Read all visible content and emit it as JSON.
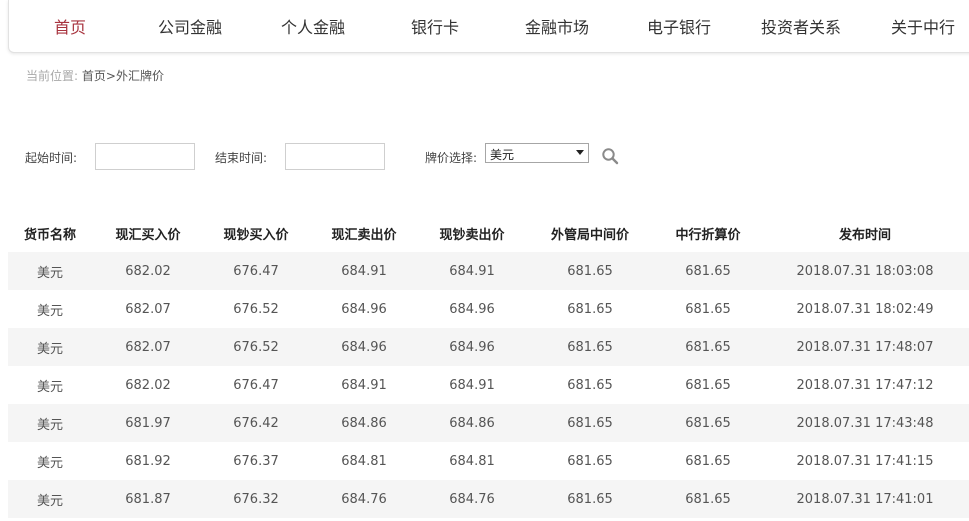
{
  "nav": {
    "items": [
      {
        "label": "首页",
        "active": true
      },
      {
        "label": "公司金融",
        "active": false
      },
      {
        "label": "个人金融",
        "active": false
      },
      {
        "label": "银行卡",
        "active": false
      },
      {
        "label": "金融市场",
        "active": false
      },
      {
        "label": "电子银行",
        "active": false
      },
      {
        "label": "投资者关系",
        "active": false
      },
      {
        "label": "关于中行",
        "active": false
      }
    ],
    "active_color": "#a8343f"
  },
  "breadcrumb": {
    "prefix": "当前位置:",
    "home": "首页",
    "separator": ">",
    "current": "外汇牌价"
  },
  "filters": {
    "start_label": "起始时间:",
    "start_value": "",
    "end_label": "结束时间:",
    "end_value": "",
    "currency_label": "牌价选择:",
    "currency_selected": "美元",
    "search_icon": "search-icon"
  },
  "table": {
    "headers": [
      "货币名称",
      "现汇买入价",
      "现钞买入价",
      "现汇卖出价",
      "现钞卖出价",
      "外管局中间价",
      "中行折算价",
      "发布时间"
    ],
    "rows": [
      [
        "美元",
        "682.02",
        "676.47",
        "684.91",
        "684.91",
        "681.65",
        "681.65",
        "2018.07.31 18:03:08"
      ],
      [
        "美元",
        "682.07",
        "676.52",
        "684.96",
        "684.96",
        "681.65",
        "681.65",
        "2018.07.31 18:02:49"
      ],
      [
        "美元",
        "682.07",
        "676.52",
        "684.96",
        "684.96",
        "681.65",
        "681.65",
        "2018.07.31 17:48:07"
      ],
      [
        "美元",
        "682.02",
        "676.47",
        "684.91",
        "684.91",
        "681.65",
        "681.65",
        "2018.07.31 17:47:12"
      ],
      [
        "美元",
        "681.97",
        "676.42",
        "684.86",
        "684.86",
        "681.65",
        "681.65",
        "2018.07.31 17:43:48"
      ],
      [
        "美元",
        "681.92",
        "676.37",
        "684.81",
        "684.81",
        "681.65",
        "681.65",
        "2018.07.31 17:41:15"
      ],
      [
        "美元",
        "681.87",
        "676.32",
        "684.76",
        "684.76",
        "681.65",
        "681.65",
        "2018.07.31 17:41:01"
      ]
    ]
  }
}
